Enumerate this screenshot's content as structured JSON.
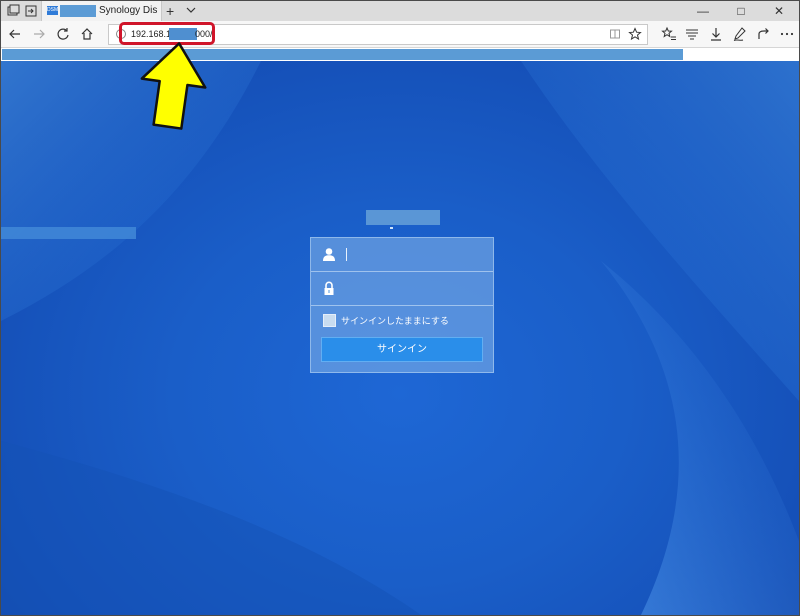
{
  "browser": {
    "tab": {
      "favicon_text": "DSM",
      "title": "Synology Dis"
    },
    "new_tab_label": "+",
    "window_controls": {
      "minimize": "—",
      "maximize": "□",
      "close": "✕"
    },
    "address_bar": {
      "url_prefix": "192.168.11",
      "url_suffix": "000/"
    },
    "page_load_progress": 0.855,
    "icons": [
      "tab-preview-icon",
      "set-aside-tabs-icon",
      "back-icon",
      "forward-icon",
      "refresh-icon",
      "home-icon",
      "site-info-icon",
      "reading-view-icon",
      "favorite-star-icon",
      "favorites-hub-icon",
      "reading-list-icon",
      "downloads-icon",
      "web-notes-icon",
      "share-icon",
      "more-icon"
    ]
  },
  "login": {
    "username_placeholder": "",
    "password_placeholder": "",
    "remember_label": "サインインしたままにする",
    "signin_label": "サインイン"
  },
  "annotation": {
    "highlight_color": "#d0152a",
    "arrow_color": "#ffff00"
  },
  "colors": {
    "page_background": "#1a5ec8",
    "signin_button": "#2a8eea",
    "redaction": "#5b9bd5"
  }
}
